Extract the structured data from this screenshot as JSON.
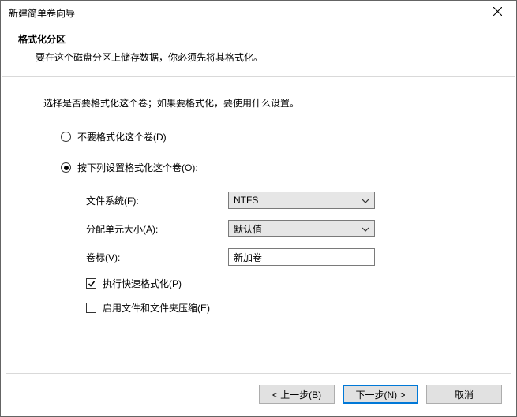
{
  "window": {
    "title": "新建简单卷向导"
  },
  "heading": {
    "title": "格式化分区",
    "subtitle": "要在这个磁盘分区上储存数据，你必须先将其格式化。"
  },
  "prompt": "选择是否要格式化这个卷；如果要格式化，要使用什么设置。",
  "options": {
    "no_format": {
      "label": "不要格式化这个卷(D)",
      "selected": false
    },
    "format_with": {
      "label": "按下列设置格式化这个卷(O):",
      "selected": true
    }
  },
  "fields": {
    "filesystem": {
      "label": "文件系统(F):",
      "value": "NTFS"
    },
    "alloc_unit": {
      "label": "分配单元大小(A):",
      "value": "默认值"
    },
    "volume_label": {
      "label": "卷标(V):",
      "value": "新加卷"
    },
    "quick_format": {
      "label": "执行快速格式化(P)",
      "checked": true
    },
    "compression": {
      "label": "启用文件和文件夹压缩(E)",
      "checked": false
    }
  },
  "buttons": {
    "back": "< 上一步(B)",
    "next": "下一步(N) >",
    "cancel": "取消"
  }
}
